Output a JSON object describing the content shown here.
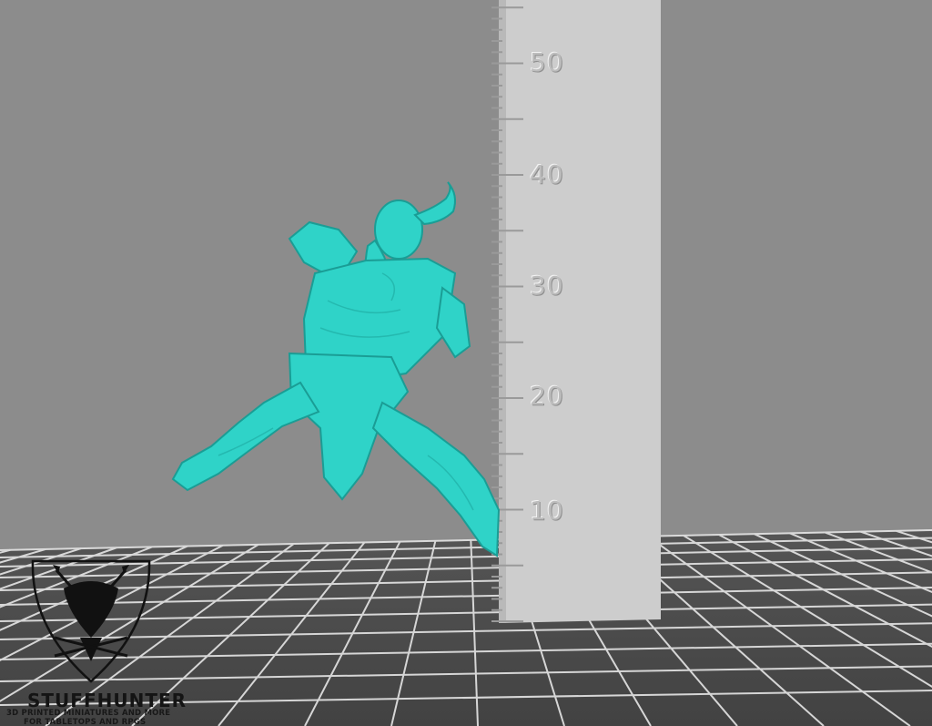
{
  "viewer": {
    "scale_ruler": {
      "unit_labels": [
        "50",
        "40",
        "30",
        "20",
        "10"
      ]
    },
    "model": {
      "description_icon": "miniature-figure-icon",
      "color": "#2ed3c8"
    },
    "background_color": "#8c8c8c",
    "floor_grid_color": "#4a4a4a"
  },
  "watermark": {
    "brand_name": "STUFFHUNTER",
    "tagline_line1": "3D PRINTED MINIATURES AND MORE",
    "tagline_line2": "FOR TABLETOPS AND RPGS"
  }
}
